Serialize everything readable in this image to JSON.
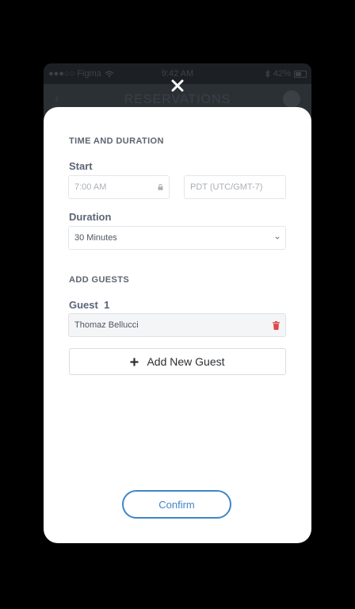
{
  "background_phone": {
    "status_left": "●●●○○ Figma",
    "status_time": "9:42 AM",
    "status_battery": "42%",
    "nav_title": "RESERVATIONS"
  },
  "modal": {
    "time_section_title": "TIME AND DURATION",
    "start_label": "Start",
    "start_time_value": "7:00 AM",
    "timezone_placeholder": "PDT (UTC/GMT-7)",
    "duration_label": "Duration",
    "duration_value": "30 Minutes",
    "guests_section_title": "ADD GUESTS",
    "guest_label": "Guest  1",
    "guest_name": "Thomaz Bellucci",
    "add_guest_label": "Add New Guest",
    "confirm_label": "Confirm"
  },
  "colors": {
    "accent": "#3f86c8",
    "delete": "#e04848",
    "sheet_bg": "#ffffff",
    "backdrop": "#000000"
  },
  "icons": {
    "close": "close-icon",
    "lock": "lock-icon",
    "chevron": "chevron-down-icon",
    "delete": "trash-icon",
    "add": "plus-icon"
  }
}
